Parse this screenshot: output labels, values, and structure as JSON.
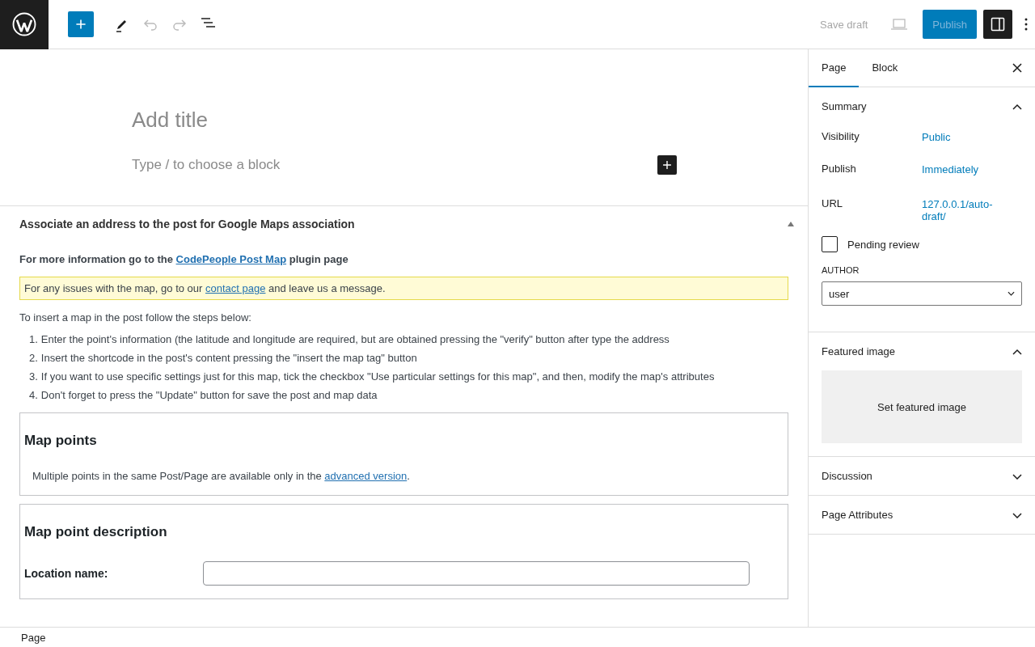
{
  "toolbar": {
    "save_draft": "Save draft",
    "publish": "Publish",
    "settings_selected": true
  },
  "editor": {
    "title_placeholder": "Add title",
    "block_placeholder": "Type / to choose a block"
  },
  "metabox": {
    "title": "Associate an address to the post for Google Maps association",
    "expanded": true,
    "info": {
      "before": "For more information go to the ",
      "link": "CodePeople Post Map",
      "after": " plugin page"
    },
    "notice": {
      "before": "For any issues with the map, go to our ",
      "link": "contact page",
      "after": " and leave us a message."
    },
    "intro": "To insert a map in the post follow the steps below:",
    "steps": [
      {
        "number": "1.",
        "text": "Enter the point's information (the latitude and longitude are required, but are obtained pressing the \"verify\" button after type the address"
      },
      {
        "number": "2.",
        "text": "Insert the shortcode in the post's content pressing the \"insert the map tag\" button"
      },
      {
        "number": "3.",
        "text": "If you want to use specific settings just for this map, tick the checkbox \"Use particular settings for this map\", and then, modify the map's attributes"
      },
      {
        "number": "4.",
        "text": "Don't forget to press the \"Update\" button for save the post and map data"
      }
    ],
    "map_points": {
      "heading": "Map points",
      "note": {
        "before": "Multiple points in the same Post/Page are available only in the ",
        "link": "advanced version",
        "after": "."
      }
    },
    "description": {
      "heading": "Map point description",
      "location_label": "Location name:"
    }
  },
  "sidebar": {
    "tabs": [
      {
        "label": "Page",
        "selected": true
      },
      {
        "label": "Block",
        "selected": false
      }
    ],
    "summary": {
      "title": "Summary",
      "expanded": true,
      "rows": [
        {
          "label": "Visibility",
          "value": "Public"
        },
        {
          "label": "Publish",
          "value": "Immediately"
        },
        {
          "label": "URL",
          "value": "127.0.0.1/auto-draft/"
        }
      ],
      "pending_review": {
        "label": "Pending review",
        "checked": false
      },
      "author_label": "AUTHOR",
      "author": "user"
    },
    "featured": {
      "title": "Featured image",
      "expanded": true,
      "button": "Set featured image"
    },
    "panels": [
      {
        "title": "Discussion",
        "expanded": false
      },
      {
        "title": "Page Attributes",
        "expanded": false
      }
    ]
  },
  "footer": {
    "breadcrumb": "Page"
  }
}
